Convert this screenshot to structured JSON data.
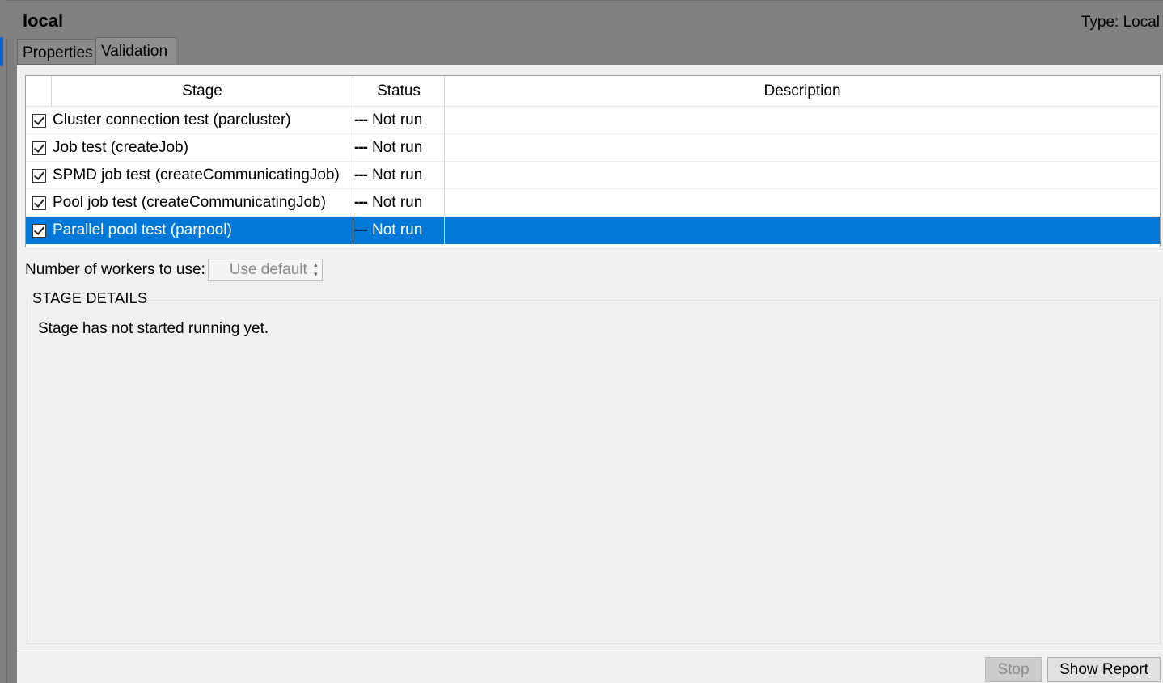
{
  "window": {
    "profile_name": "local",
    "profile_type": "Type: Local"
  },
  "tabs": [
    {
      "label": "Properties",
      "active": false
    },
    {
      "label": "Validation",
      "active": true
    }
  ],
  "table": {
    "headers": {
      "stage": "Stage",
      "status": "Status",
      "description": "Description"
    },
    "rows": [
      {
        "stage": "Cluster connection test (parcluster)",
        "status_marker": "---",
        "status": "Not run",
        "description": "",
        "checked": true,
        "selected": false
      },
      {
        "stage": "Job test (createJob)",
        "status_marker": "---",
        "status": "Not run",
        "description": "",
        "checked": true,
        "selected": false
      },
      {
        "stage": "SPMD job test (createCommunicatingJob)",
        "status_marker": "---",
        "status": "Not run",
        "description": "",
        "checked": true,
        "selected": false
      },
      {
        "stage": "Pool job test (createCommunicatingJob)",
        "status_marker": "---",
        "status": "Not run",
        "description": "",
        "checked": true,
        "selected": false
      },
      {
        "stage": "Parallel pool test (parpool)",
        "status_marker": "---",
        "status": "Not run",
        "description": "",
        "checked": true,
        "selected": true
      }
    ]
  },
  "workers": {
    "label": "Number of workers to use:",
    "value": "Use default"
  },
  "stage_details": {
    "header": "STAGE DETAILS",
    "text": "Stage has not started running yet."
  },
  "buttons": {
    "stop": "Stop",
    "show_report": "Show Report"
  },
  "colors": {
    "selection": "#0078d7",
    "panel_bg": "#f0f0f0",
    "chrome_bg": "#808080"
  }
}
